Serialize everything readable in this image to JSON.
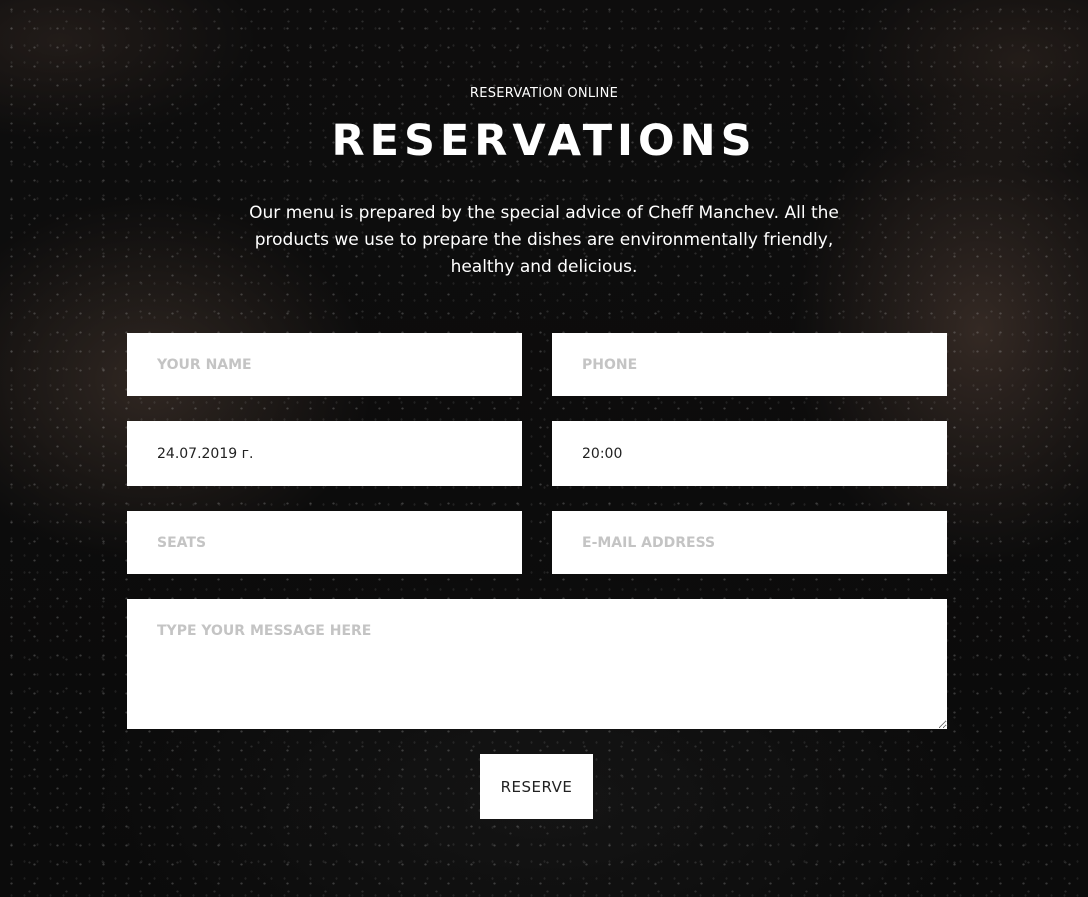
{
  "header": {
    "kicker": "RESERVATION ONLINE",
    "title": "RESERVATIONS",
    "lead": "Our menu is prepared by the special advice of Cheff Manchev. All the products we use to prepare the dishes are environmentally friendly, healthy and delicious."
  },
  "form": {
    "name": {
      "placeholder": "YOUR NAME",
      "value": ""
    },
    "phone": {
      "placeholder": "PHONE",
      "value": ""
    },
    "date": {
      "value": "24.07.2019 г."
    },
    "time": {
      "value": "20:00"
    },
    "seats": {
      "placeholder": "SEATS",
      "value": ""
    },
    "email": {
      "placeholder": "E-MAIL ADDRESS",
      "value": ""
    },
    "message": {
      "placeholder": "TYPE YOUR MESSAGE HERE",
      "value": ""
    },
    "submit_label": "RESERVE"
  },
  "colors": {
    "field_background": "#ffffff",
    "placeholder": "#c4c4c4",
    "text_on_dark": "#ffffff"
  }
}
